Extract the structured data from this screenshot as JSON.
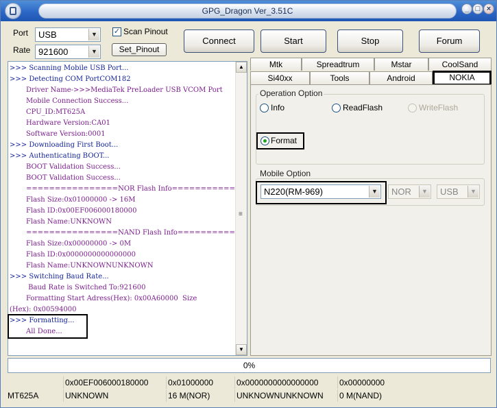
{
  "window": {
    "title": "GPG_Dragon  Ver_3.51C"
  },
  "titlebar": {
    "minimize": "_",
    "maximize": "□",
    "close": "×"
  },
  "port": {
    "label": "Port",
    "value": "USB"
  },
  "rate": {
    "label": "Rate",
    "value": "921600"
  },
  "scan_pinout": {
    "label": "Scan Pinout",
    "checked": true,
    "mark": "✓"
  },
  "buttons": {
    "set_pinout": "Set_Pinout",
    "connect": "Connect",
    "start": "Start",
    "stop": "Stop",
    "forum": "Forum"
  },
  "log_lines": [
    {
      "text": ">>> Scanning Mobile USB Port...",
      "color": "blue"
    },
    {
      "text": ">>> Detecting COM PortCOM182",
      "color": "blue"
    },
    {
      "text": "Driver Name->>>MediaTek PreLoader USB VCOM Port",
      "color": "purple"
    },
    {
      "text": "Mobile Connection Success...",
      "color": "purple"
    },
    {
      "text": "CPU_ID:MT625A",
      "color": "purple"
    },
    {
      "text": "Hardware Version:CA01",
      "color": "purple"
    },
    {
      "text": "Software Version:0001",
      "color": "purple"
    },
    {
      "text": ">>> Downloading First Boot...",
      "color": "blue"
    },
    {
      "text": ">>> Authenticating BOOT...",
      "color": "blue"
    },
    {
      "text": "BOOT Validation Success...",
      "color": "purple"
    },
    {
      "text": "BOOT Validation Success...",
      "color": "purple"
    },
    {
      "text": "================NOR Flash Info================",
      "color": "purple"
    },
    {
      "text": "Flash Size:0x01000000 -> 16M",
      "color": "purple"
    },
    {
      "text": "Flash ID:0x00EF006000180000",
      "color": "purple"
    },
    {
      "text": "Flash Name:UNKNOWN",
      "color": "purple"
    },
    {
      "text": "================NAND Flash Info================",
      "color": "purple"
    },
    {
      "text": "Flash Size:0x00000000 -> 0M",
      "color": "purple"
    },
    {
      "text": "Flash ID:0x0000000000000000",
      "color": "purple"
    },
    {
      "text": "Flash Name:UNKNOWNUNKNOWN",
      "color": "purple"
    },
    {
      "text": ">>> Switching Baud Rate...",
      "color": "blue"
    },
    {
      "text": " Baud Rate is Switched To:921600",
      "color": "purple"
    },
    {
      "text": "Formatting Start Adress(Hex): 0x00A60000  Size",
      "color": "purple"
    },
    {
      "text": "(Hex): 0x00594000",
      "color": "purple"
    },
    {
      "text": ">>> Formatting...",
      "color": "blue"
    },
    {
      "text": "All Done...",
      "color": "purple"
    }
  ],
  "tabs_row1": [
    "Mtk",
    "Spreadtrum",
    "Mstar",
    "CoolSand"
  ],
  "tabs_row2": [
    "Si40xx",
    "Tools",
    "Android",
    "NOKIA"
  ],
  "active_tab": "NOKIA",
  "operation": {
    "title": "Operation Option",
    "info": "Info",
    "read_flash": "ReadFlash",
    "write_flash": "WriteFlash",
    "format": "Format",
    "selected": "Format"
  },
  "mobile": {
    "title": "Mobile Option",
    "model": "N220(RM-969)",
    "flash_type": "NOR",
    "connection": "USB"
  },
  "progress": {
    "text": "0%",
    "value": 0
  },
  "status_row1": [
    "",
    "0x00EF006000180000",
    "0x01000000",
    "0x0000000000000000",
    "0x00000000"
  ],
  "status_row2": [
    "MT625A",
    "UNKNOWN",
    "16 M(NOR)",
    "UNKNOWNUNKNOWN",
    "0 M(NAND)"
  ],
  "colors": {
    "log_blue": "#13239a",
    "log_purple": "#7a1e8c",
    "radio_selected": "#21a121",
    "title_bar": "#2a64c4"
  },
  "icons": {
    "app": "dragon-app-icon",
    "dropdown": "chevron-down-icon"
  },
  "glyphs": {
    "dropdown_arrow": "▼",
    "scroll_up": "▲",
    "scroll_down": "▼",
    "scroll_grip": "≡"
  }
}
